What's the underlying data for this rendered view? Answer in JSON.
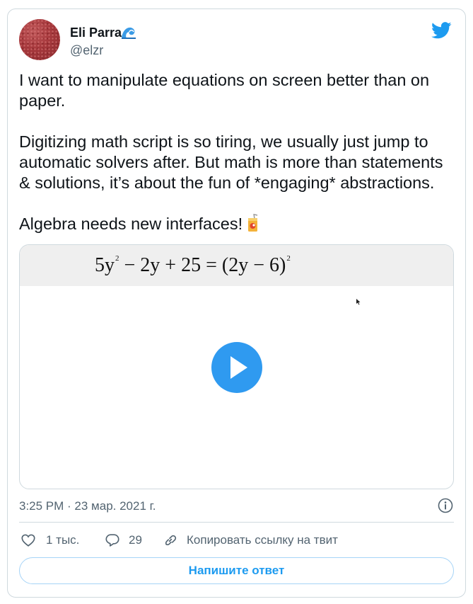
{
  "tweet": {
    "author_name": "Eli Parra",
    "author_handle": "@elzr",
    "paragraphs": [
      "I want to manipulate equations on screen better than on paper.",
      "Digitizing math script is so tiring, we usually just jump to automatic solvers after. But math is more than statements & solutions, it’s about the fun of *engaging* abstractions.",
      "Algebra needs new interfaces!"
    ],
    "media": {
      "equation": {
        "left_a": "5y",
        "sup_a": "2",
        "left_b": " − 2y + 25 ",
        "equals": "=",
        "right_a": " (2y − 6)",
        "sup_b": "2"
      }
    },
    "timestamp": "3:25 PM · 23 мар. 2021 г.",
    "actions": {
      "like_count": "1 тыс.",
      "reply_count": "29",
      "copy_link_label": "Копировать ссылку на твит"
    },
    "reply_button_label": "Напишите ответ"
  },
  "icons": {
    "author_badge": "wave-emoji-icon",
    "brand": "twitter-bird-icon",
    "text_emoji": "juice-box-emoji-icon",
    "play": "play-icon",
    "info": "info-icon",
    "like": "heart-icon",
    "reply": "speech-bubble-icon",
    "copy": "link-icon"
  },
  "colors": {
    "accent": "#1d9bf0",
    "play_button": "#2f9af0",
    "muted_text": "#536471",
    "border": "#cfd9de",
    "avatar": "#a6383c"
  }
}
